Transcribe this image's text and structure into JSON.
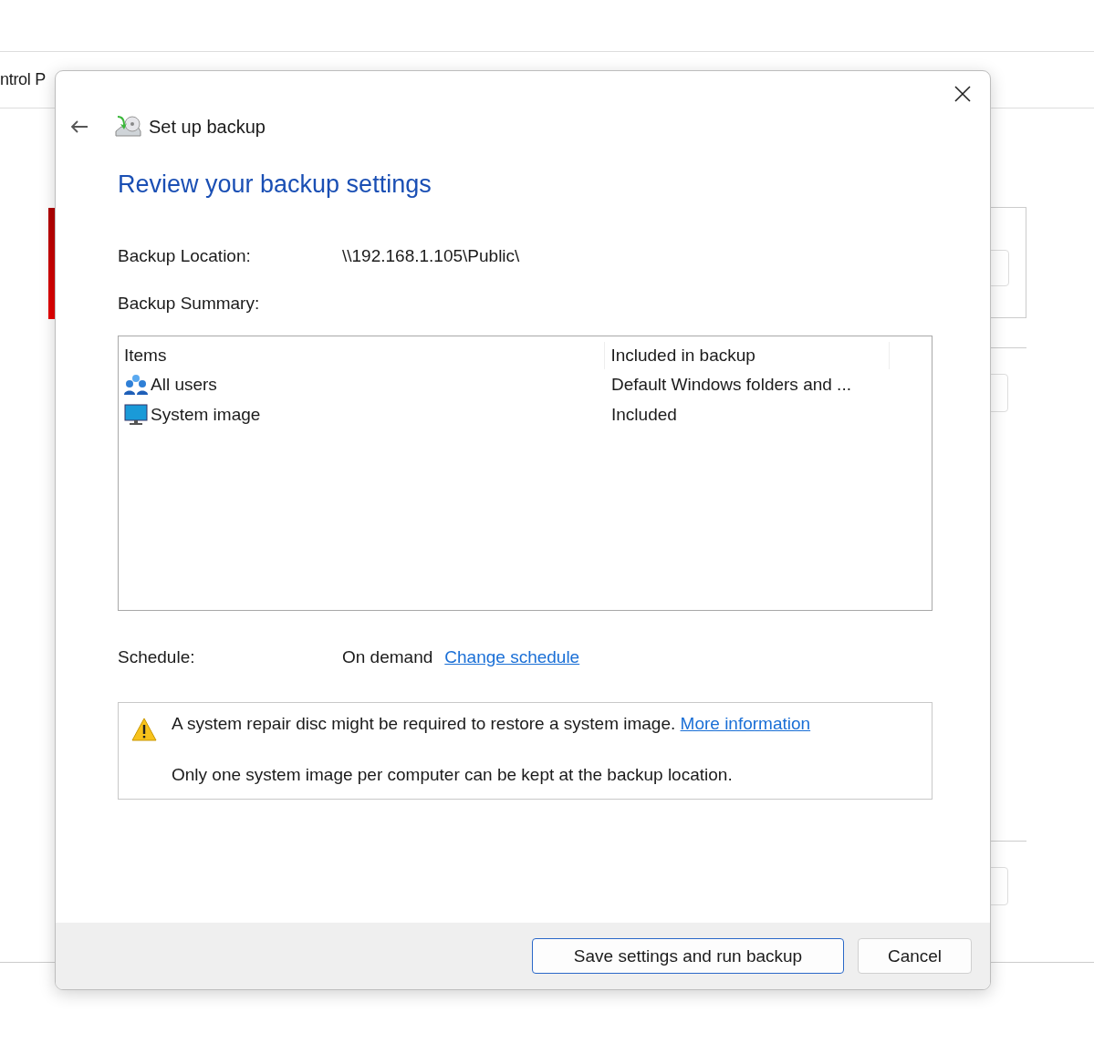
{
  "background_window": {
    "breadcrumb_fragment": "ntrol P"
  },
  "dialog": {
    "title": "Set up backup",
    "heading": "Review your backup settings",
    "location_label": "Backup Location:",
    "location_value": "\\\\192.168.1.105\\Public\\",
    "summary_label": "Backup Summary:",
    "table": {
      "columns": [
        "Items",
        "Included in backup"
      ],
      "rows": [
        {
          "kind": "users",
          "item": "All users",
          "included": "Default Windows folders and ..."
        },
        {
          "kind": "system",
          "item": "System image",
          "included": "Included"
        }
      ]
    },
    "schedule_label": "Schedule:",
    "schedule_value": "On demand",
    "schedule_link": "Change schedule",
    "warning": {
      "text": "A system repair disc might be required to restore a system image.",
      "link": "More information",
      "note": "Only one system image per computer can be kept at the backup location."
    },
    "buttons": [
      {
        "label": "Save settings and run backup",
        "default": true
      },
      {
        "label": "Cancel",
        "default": false
      }
    ]
  }
}
